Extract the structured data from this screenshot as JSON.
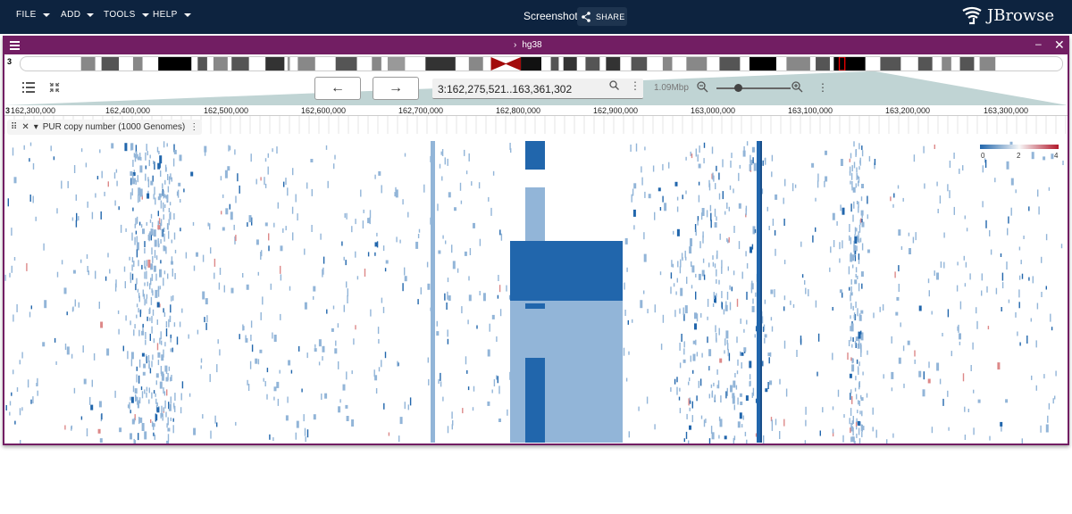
{
  "menu": {
    "items": [
      {
        "label": "FILE"
      },
      {
        "label": "ADD"
      },
      {
        "label": "TOOLS"
      },
      {
        "label": "HELP"
      }
    ]
  },
  "session_name": "Screenshot",
  "share_label": "SHARE",
  "logo_text": "JBrowse",
  "view": {
    "assembly": "hg38",
    "chrom_label": "3",
    "location": "3:162,275,521..163,361,302",
    "bp_per_view": "1.09Mbp",
    "ruler_ticks": [
      "162,300,000",
      "162,400,000",
      "162,500,000",
      "162,600,000",
      "162,700,000",
      "162,800,000",
      "162,900,000",
      "163,000,000",
      "163,100,000",
      "163,200,000",
      "163,300,000"
    ],
    "ruler_chrom": "3"
  },
  "track": {
    "name": "PUR copy number (1000 Genomes)",
    "legend_ticks": [
      "0",
      "2",
      "4"
    ]
  },
  "colors": {
    "appbar": "#0d233f",
    "view_accent": "#721e63",
    "loss": "#2166ac",
    "loss_light": "#92b5d8",
    "gain": "#b2182b"
  },
  "icons": [
    "hamburger-icon",
    "chevron-right-icon",
    "minimize-icon",
    "close-icon",
    "search-icon",
    "zoom-in-icon",
    "zoom-out-icon",
    "more-vert-icon",
    "arrow-left-icon",
    "arrow-right-icon",
    "share-icon",
    "drag-handle-icon"
  ]
}
